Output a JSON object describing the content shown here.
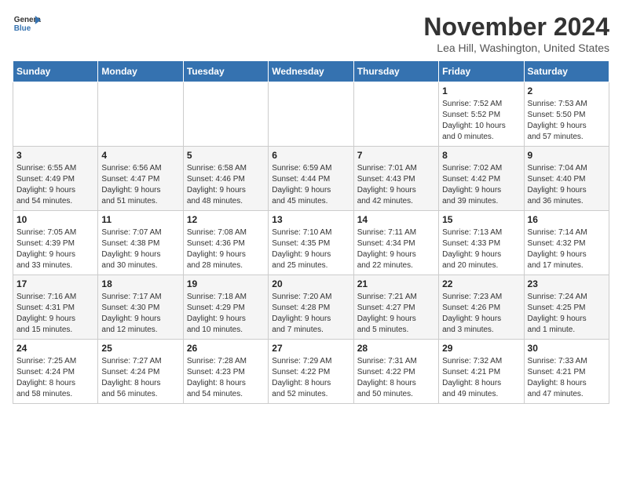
{
  "header": {
    "logo_line1": "General",
    "logo_line2": "Blue",
    "month": "November 2024",
    "location": "Lea Hill, Washington, United States"
  },
  "weekdays": [
    "Sunday",
    "Monday",
    "Tuesday",
    "Wednesday",
    "Thursday",
    "Friday",
    "Saturday"
  ],
  "weeks": [
    [
      {
        "day": "",
        "info": ""
      },
      {
        "day": "",
        "info": ""
      },
      {
        "day": "",
        "info": ""
      },
      {
        "day": "",
        "info": ""
      },
      {
        "day": "",
        "info": ""
      },
      {
        "day": "1",
        "info": "Sunrise: 7:52 AM\nSunset: 5:52 PM\nDaylight: 10 hours\nand 0 minutes."
      },
      {
        "day": "2",
        "info": "Sunrise: 7:53 AM\nSunset: 5:50 PM\nDaylight: 9 hours\nand 57 minutes."
      }
    ],
    [
      {
        "day": "3",
        "info": "Sunrise: 6:55 AM\nSunset: 4:49 PM\nDaylight: 9 hours\nand 54 minutes."
      },
      {
        "day": "4",
        "info": "Sunrise: 6:56 AM\nSunset: 4:47 PM\nDaylight: 9 hours\nand 51 minutes."
      },
      {
        "day": "5",
        "info": "Sunrise: 6:58 AM\nSunset: 4:46 PM\nDaylight: 9 hours\nand 48 minutes."
      },
      {
        "day": "6",
        "info": "Sunrise: 6:59 AM\nSunset: 4:44 PM\nDaylight: 9 hours\nand 45 minutes."
      },
      {
        "day": "7",
        "info": "Sunrise: 7:01 AM\nSunset: 4:43 PM\nDaylight: 9 hours\nand 42 minutes."
      },
      {
        "day": "8",
        "info": "Sunrise: 7:02 AM\nSunset: 4:42 PM\nDaylight: 9 hours\nand 39 minutes."
      },
      {
        "day": "9",
        "info": "Sunrise: 7:04 AM\nSunset: 4:40 PM\nDaylight: 9 hours\nand 36 minutes."
      }
    ],
    [
      {
        "day": "10",
        "info": "Sunrise: 7:05 AM\nSunset: 4:39 PM\nDaylight: 9 hours\nand 33 minutes."
      },
      {
        "day": "11",
        "info": "Sunrise: 7:07 AM\nSunset: 4:38 PM\nDaylight: 9 hours\nand 30 minutes."
      },
      {
        "day": "12",
        "info": "Sunrise: 7:08 AM\nSunset: 4:36 PM\nDaylight: 9 hours\nand 28 minutes."
      },
      {
        "day": "13",
        "info": "Sunrise: 7:10 AM\nSunset: 4:35 PM\nDaylight: 9 hours\nand 25 minutes."
      },
      {
        "day": "14",
        "info": "Sunrise: 7:11 AM\nSunset: 4:34 PM\nDaylight: 9 hours\nand 22 minutes."
      },
      {
        "day": "15",
        "info": "Sunrise: 7:13 AM\nSunset: 4:33 PM\nDaylight: 9 hours\nand 20 minutes."
      },
      {
        "day": "16",
        "info": "Sunrise: 7:14 AM\nSunset: 4:32 PM\nDaylight: 9 hours\nand 17 minutes."
      }
    ],
    [
      {
        "day": "17",
        "info": "Sunrise: 7:16 AM\nSunset: 4:31 PM\nDaylight: 9 hours\nand 15 minutes."
      },
      {
        "day": "18",
        "info": "Sunrise: 7:17 AM\nSunset: 4:30 PM\nDaylight: 9 hours\nand 12 minutes."
      },
      {
        "day": "19",
        "info": "Sunrise: 7:18 AM\nSunset: 4:29 PM\nDaylight: 9 hours\nand 10 minutes."
      },
      {
        "day": "20",
        "info": "Sunrise: 7:20 AM\nSunset: 4:28 PM\nDaylight: 9 hours\nand 7 minutes."
      },
      {
        "day": "21",
        "info": "Sunrise: 7:21 AM\nSunset: 4:27 PM\nDaylight: 9 hours\nand 5 minutes."
      },
      {
        "day": "22",
        "info": "Sunrise: 7:23 AM\nSunset: 4:26 PM\nDaylight: 9 hours\nand 3 minutes."
      },
      {
        "day": "23",
        "info": "Sunrise: 7:24 AM\nSunset: 4:25 PM\nDaylight: 9 hours\nand 1 minute."
      }
    ],
    [
      {
        "day": "24",
        "info": "Sunrise: 7:25 AM\nSunset: 4:24 PM\nDaylight: 8 hours\nand 58 minutes."
      },
      {
        "day": "25",
        "info": "Sunrise: 7:27 AM\nSunset: 4:24 PM\nDaylight: 8 hours\nand 56 minutes."
      },
      {
        "day": "26",
        "info": "Sunrise: 7:28 AM\nSunset: 4:23 PM\nDaylight: 8 hours\nand 54 minutes."
      },
      {
        "day": "27",
        "info": "Sunrise: 7:29 AM\nSunset: 4:22 PM\nDaylight: 8 hours\nand 52 minutes."
      },
      {
        "day": "28",
        "info": "Sunrise: 7:31 AM\nSunset: 4:22 PM\nDaylight: 8 hours\nand 50 minutes."
      },
      {
        "day": "29",
        "info": "Sunrise: 7:32 AM\nSunset: 4:21 PM\nDaylight: 8 hours\nand 49 minutes."
      },
      {
        "day": "30",
        "info": "Sunrise: 7:33 AM\nSunset: 4:21 PM\nDaylight: 8 hours\nand 47 minutes."
      }
    ]
  ]
}
